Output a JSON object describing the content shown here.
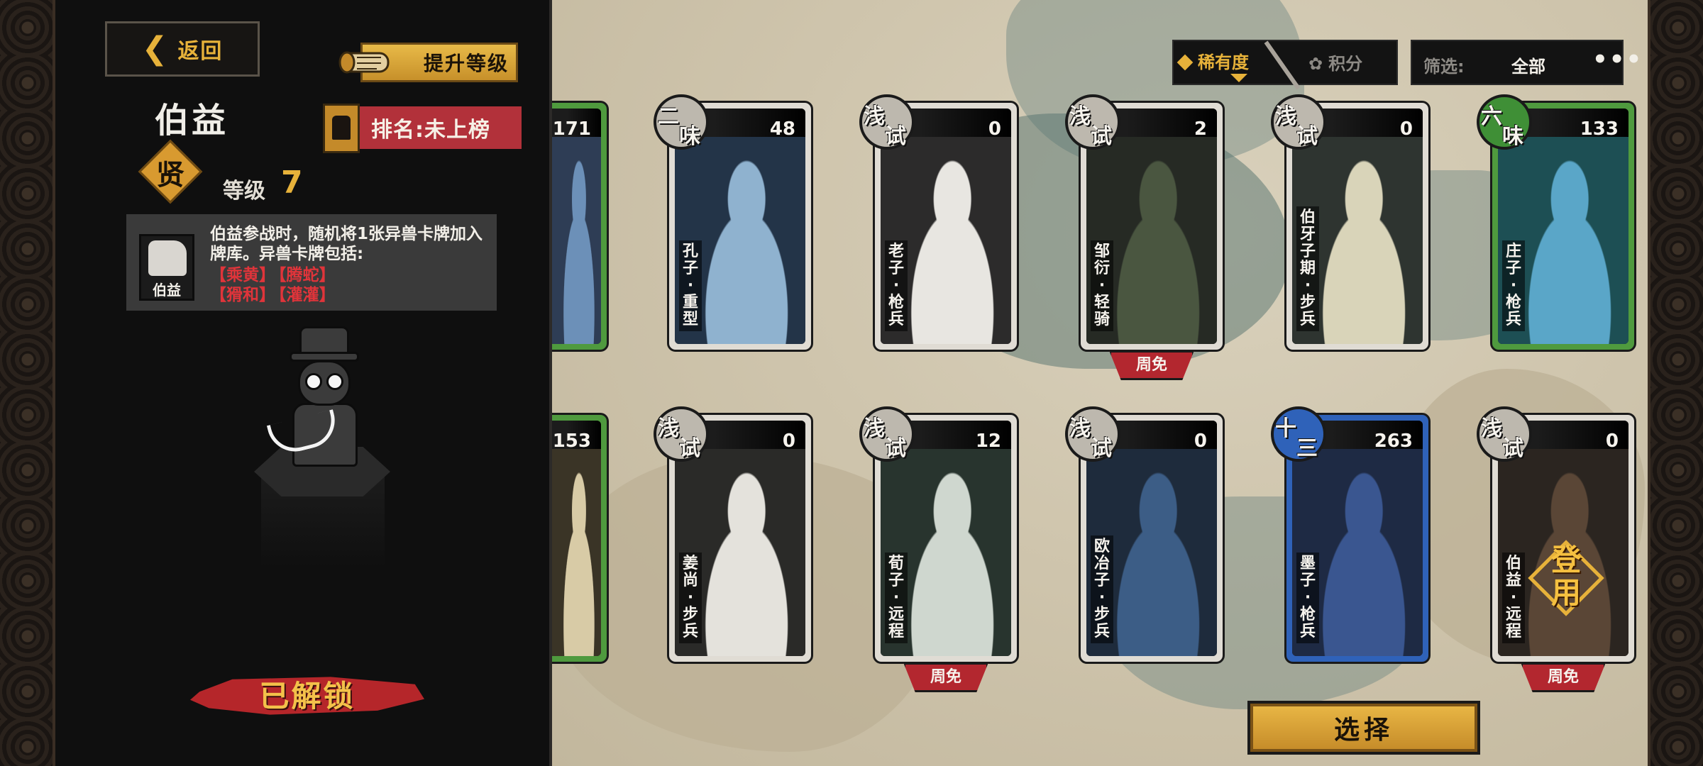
{
  "panel": {
    "back_label": "返回",
    "upgrade_label": "提升等级",
    "hero_name": "伯益",
    "rank_text": "排名:未上榜",
    "grade": "贤",
    "level_label": "等级",
    "level_value": "7",
    "skill": {
      "icon_label": "伯益",
      "description": "伯益参战时，随机将1张异兽卡牌加入牌库。异兽卡牌包括:",
      "tags": [
        "【乘黄】",
        "【腾蛇】",
        "【猾和】",
        "【灌灌】"
      ]
    },
    "status": "已解锁"
  },
  "sort": {
    "rarity_label": "稀有度",
    "score_label": "积分"
  },
  "filter": {
    "label": "筛选:",
    "value": "全部",
    "more": "•••"
  },
  "cards": [
    {
      "count": "171",
      "badge1": "",
      "badge2": "",
      "name": "",
      "frame": "green",
      "week_free": false,
      "stamp": false
    },
    {
      "count": "48",
      "badge1": "二",
      "badge2": "味",
      "name": "孔子·重型",
      "frame": "white",
      "week_free": false,
      "stamp": false
    },
    {
      "count": "0",
      "badge1": "浅",
      "badge2": "试",
      "name": "老子·枪兵",
      "frame": "white",
      "week_free": false,
      "stamp": false
    },
    {
      "count": "2",
      "badge1": "浅",
      "badge2": "试",
      "name": "邹衍·轻骑",
      "frame": "white",
      "week_free": true,
      "stamp": false
    },
    {
      "count": "0",
      "badge1": "浅",
      "badge2": "试",
      "name": "伯牙子期·步兵",
      "frame": "white",
      "week_free": false,
      "stamp": false
    },
    {
      "count": "133",
      "badge1": "六",
      "badge2": "味",
      "name": "庄子·枪兵",
      "frame": "green",
      "week_free": false,
      "stamp": false
    },
    {
      "count": "153",
      "badge1": "",
      "badge2": "",
      "name": "",
      "frame": "green",
      "week_free": false,
      "stamp": false
    },
    {
      "count": "0",
      "badge1": "浅",
      "badge2": "试",
      "name": "姜尚·步兵",
      "frame": "white",
      "week_free": false,
      "stamp": false
    },
    {
      "count": "12",
      "badge1": "浅",
      "badge2": "试",
      "name": "荀子·远程",
      "frame": "white",
      "week_free": true,
      "stamp": false
    },
    {
      "count": "0",
      "badge1": "浅",
      "badge2": "试",
      "name": "欧冶子·步兵",
      "frame": "white",
      "week_free": false,
      "stamp": false
    },
    {
      "count": "263",
      "badge1": "十",
      "badge2": "三",
      "name": "墨子·枪兵",
      "frame": "blue",
      "week_free": false,
      "stamp": false
    },
    {
      "count": "0",
      "badge1": "浅",
      "badge2": "试",
      "name": "伯益·远程",
      "frame": "white",
      "week_free": true,
      "stamp": true
    }
  ],
  "week_free_label": "周免",
  "stamp_label": "登用",
  "select_label": "选择"
}
